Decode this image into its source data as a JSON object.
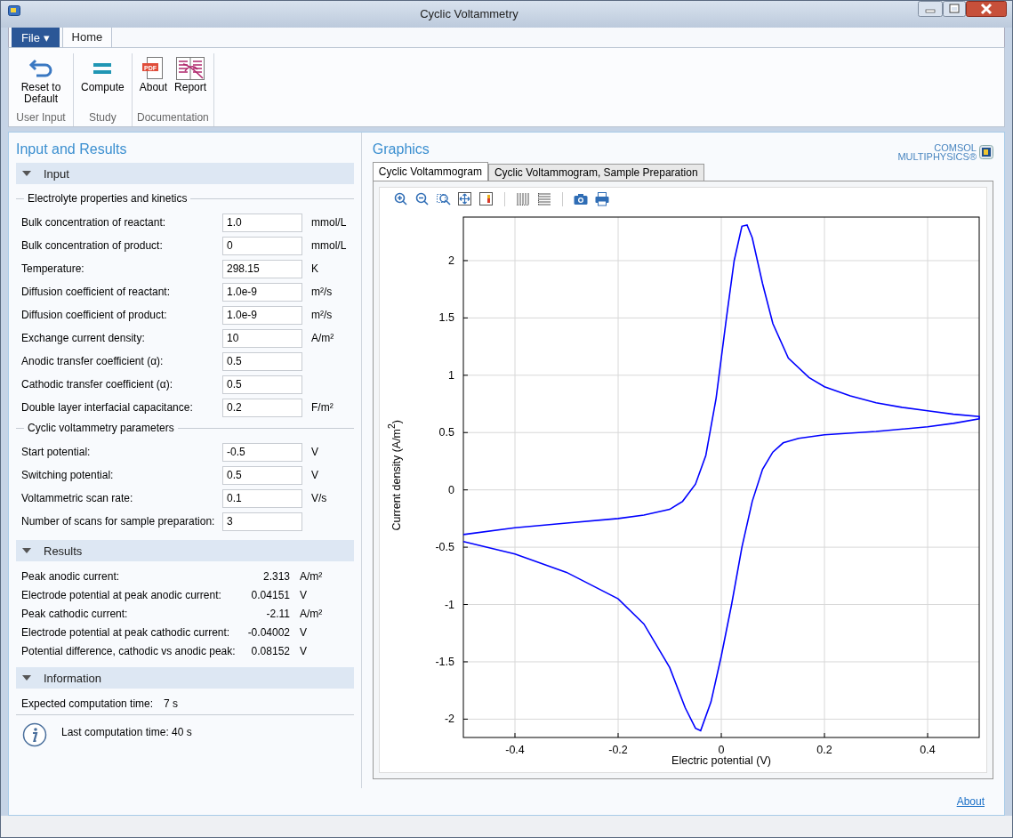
{
  "window": {
    "title": "Cyclic Voltammetry"
  },
  "ribbon_tabs": [
    {
      "label": "File ▾",
      "kind": "file",
      "selected": false
    },
    {
      "label": "Home",
      "kind": "tab",
      "selected": true
    }
  ],
  "ribbon_groups": [
    {
      "label": "User Input",
      "buttons": [
        {
          "label": "Reset to Default"
        }
      ]
    },
    {
      "label": "Study",
      "buttons": [
        {
          "label": "Compute"
        }
      ]
    },
    {
      "label": "Documentation",
      "buttons": [
        {
          "label": "About",
          "icon_text": "PDF"
        },
        {
          "label": "Report"
        }
      ]
    }
  ],
  "left_panel": {
    "title": "Input and Results",
    "sections": [
      {
        "title": "Input",
        "kind": "input",
        "expanded": true,
        "groups": [
          {
            "title": "Electrolyte properties and kinetics",
            "fields": [
              {
                "label": "Bulk concentration of reactant:",
                "value": "1.0",
                "unit": "mmol/L"
              },
              {
                "label": "Bulk concentration of product:",
                "value": "0",
                "unit": "mmol/L"
              },
              {
                "label": "Temperature:",
                "value": "298.15",
                "unit": "K"
              },
              {
                "label": "Diffusion coefficient of reactant:",
                "value": "1.0e-9",
                "unit": "m²/s"
              },
              {
                "label": "Diffusion coefficient of product:",
                "value": "1.0e-9",
                "unit": "m²/s"
              },
              {
                "label": "Exchange current density:",
                "value": "10",
                "unit": "A/m²"
              },
              {
                "label": "Anodic transfer coefficient (α):",
                "value": "0.5"
              },
              {
                "label": "Cathodic transfer coefficient (α):",
                "value": "0.5"
              },
              {
                "label": "Double layer interfacial capacitance:",
                "value": "0.2",
                "unit": "F/m²"
              }
            ]
          },
          {
            "title": "Cyclic voltammetry parameters",
            "fields": [
              {
                "label": "Start potential:",
                "value": "-0.5",
                "unit": "V"
              },
              {
                "label": "Switching potential:",
                "value": "0.5",
                "unit": "V"
              },
              {
                "label": "Voltammetric scan rate:",
                "value": "0.1",
                "unit": "V/s"
              },
              {
                "label": "Number of scans for sample preparation:",
                "value": "3"
              }
            ]
          }
        ]
      },
      {
        "title": "Results",
        "kind": "results",
        "expanded": true,
        "rows": [
          {
            "label": "Peak anodic current:",
            "value": "2.313",
            "unit": "A/m²"
          },
          {
            "label": "Electrode potential at peak anodic current:",
            "value": "0.04151",
            "unit": "V"
          },
          {
            "label": "Peak cathodic current:",
            "value": "-2.11",
            "unit": "A/m²"
          },
          {
            "label": "Electrode potential at peak cathodic current:",
            "value": "-0.04002",
            "unit": "V"
          },
          {
            "label": "Potential difference, cathodic vs anodic peak:",
            "value": "0.08152",
            "unit": "V"
          }
        ]
      },
      {
        "title": "Information",
        "kind": "info",
        "expanded": true,
        "expected_label": "Expected computation time:",
        "expected_value": "7 s",
        "message": "Last computation time: 40 s"
      }
    ]
  },
  "graphics": {
    "title": "Graphics",
    "logo_line_1": "COMSOL",
    "logo_line_2": "MULTIPHYSICS®",
    "tabs": [
      {
        "label": "Cyclic Voltammogram",
        "selected": true
      },
      {
        "label": "Cyclic Voltammogram, Sample Preparation",
        "selected": false
      }
    ],
    "chart_data": {
      "type": "line",
      "xlabel": "Electric potential (V)",
      "ylabel": "Current density (A/m$^{2}$)",
      "x": [
        -0.5,
        -0.4,
        -0.3,
        -0.2,
        -0.15,
        -0.1,
        -0.075,
        -0.05,
        -0.03,
        -0.01,
        0.01,
        0.025,
        0.04,
        0.05,
        0.06,
        0.08,
        0.1,
        0.13,
        0.17,
        0.2,
        0.25,
        0.3,
        0.35,
        0.4,
        0.45,
        0.5,
        0.5,
        0.45,
        0.4,
        0.3,
        0.2,
        0.15,
        0.12,
        0.1,
        0.08,
        0.06,
        0.04,
        0.02,
        0,
        -0.02,
        -0.04,
        -0.05,
        -0.07,
        -0.1,
        -0.15,
        -0.2,
        -0.3,
        -0.4,
        -0.5
      ],
      "grid": true,
      "series": [
        {
          "color": "#0000ff",
          "values": [
            -0.39,
            -0.33,
            -0.29,
            -0.25,
            -0.22,
            -0.17,
            -0.1,
            0.05,
            0.3,
            0.8,
            1.5,
            2.0,
            2.3,
            2.31,
            2.2,
            1.8,
            1.45,
            1.15,
            0.98,
            0.9,
            0.82,
            0.76,
            0.72,
            0.69,
            0.66,
            0.64,
            0.62,
            0.58,
            0.55,
            0.51,
            0.48,
            0.45,
            0.41,
            0.33,
            0.18,
            -0.1,
            -0.5,
            -1.0,
            -1.45,
            -1.85,
            -2.1,
            -2.08,
            -1.9,
            -1.55,
            -1.17,
            -0.95,
            -0.72,
            -0.56,
            -0.45
          ]
        }
      ],
      "xlim": [
        -0.5,
        0.5
      ],
      "ylim": [
        -2.16,
        2.38
      ],
      "xticks": [
        -0.4,
        -0.2,
        0,
        0.2,
        0.4
      ],
      "yticks": [
        -2,
        -1.5,
        -1,
        -0.5,
        0,
        0.5,
        1,
        1.5,
        2
      ]
    }
  },
  "footer_link": "About"
}
